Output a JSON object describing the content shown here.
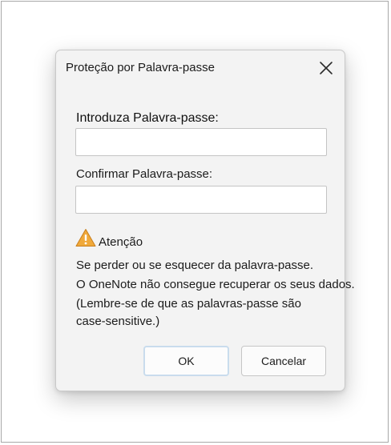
{
  "dialog": {
    "title": "Proteção por Palavra-passe",
    "close_icon": "close-icon",
    "password_label": "Introduza Palavra-passe:",
    "password_value": "",
    "confirm_label": "Confirmar Palavra-passe:",
    "confirm_value": "",
    "warning": {
      "icon": "warning-triangle-icon",
      "title": "Atenção",
      "lines": [
        "Se perder ou se esquecer da palavra-passe.",
        "O OneNote não consegue recuperar os seus dados.",
        "(Lembre-se de que as palavras-passe são",
        "case-sensitive.)"
      ]
    },
    "ok_label": "OK",
    "cancel_label": "Cancelar"
  },
  "colors": {
    "dialog_bg": "#f3f3f3",
    "warning_fill": "#f0a93b",
    "ok_focus_border": "#c9dced"
  }
}
